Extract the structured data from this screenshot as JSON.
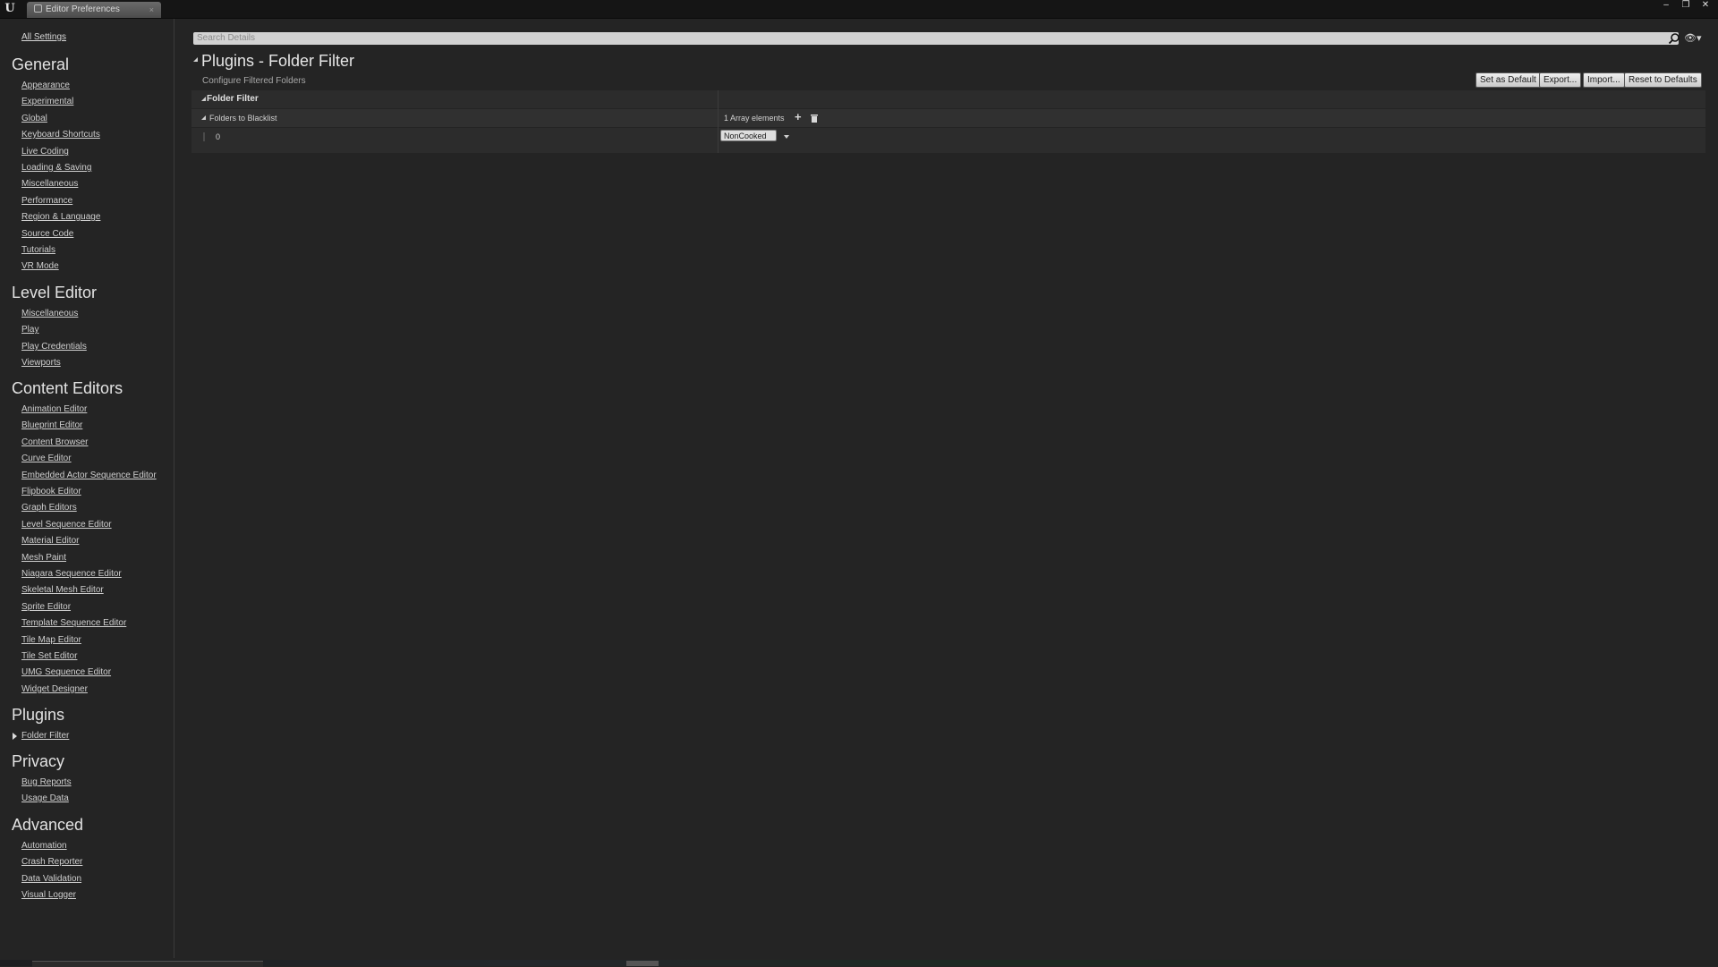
{
  "window": {
    "tab_title": "Editor Preferences",
    "tab_close": "×",
    "minimize": "–",
    "maximize": "❐",
    "close": "✕",
    "logo": "U"
  },
  "sidebar": {
    "all_settings": "All Settings",
    "categories": [
      {
        "title": "General",
        "items": [
          "Appearance",
          "Experimental",
          "Global",
          "Keyboard Shortcuts",
          "Live Coding",
          "Loading & Saving",
          "Miscellaneous",
          "Performance",
          "Region & Language",
          "Source Code",
          "Tutorials",
          "VR Mode"
        ]
      },
      {
        "title": "Level Editor",
        "items": [
          "Miscellaneous",
          "Play",
          "Play Credentials",
          "Viewports"
        ]
      },
      {
        "title": "Content Editors",
        "items": [
          "Animation Editor",
          "Blueprint Editor",
          "Content Browser",
          "Curve Editor",
          "Embedded Actor Sequence Editor",
          "Flipbook Editor",
          "Graph Editors",
          "Level Sequence Editor",
          "Material Editor",
          "Mesh Paint",
          "Niagara Sequence Editor",
          "Skeletal Mesh Editor",
          "Sprite Editor",
          "Template Sequence Editor",
          "Tile Map Editor",
          "Tile Set Editor",
          "UMG Sequence Editor",
          "Widget Designer"
        ]
      },
      {
        "title": "Plugins",
        "items": [
          "Folder Filter"
        ]
      },
      {
        "title": "Privacy",
        "items": [
          "Bug Reports",
          "Usage Data"
        ]
      },
      {
        "title": "Advanced",
        "items": [
          "Automation",
          "Crash Reporter",
          "Data Validation",
          "Visual Logger"
        ]
      }
    ],
    "selected": "Folder Filter"
  },
  "main": {
    "search_placeholder": "Search Details",
    "title": "Plugins - Folder Filter",
    "subtitle": "Configure Filtered Folders",
    "buttons": {
      "set_default": "Set as Default",
      "export": "Export...",
      "import": "Import...",
      "reset": "Reset to Defaults"
    },
    "section": {
      "title": "Folder Filter",
      "array_label": "Folders to Blacklist",
      "array_count": "1 Array elements",
      "add_icon": "+",
      "delete_icon": "🗑",
      "element_index": "0",
      "element_value": "NonCooked"
    }
  },
  "colors": {
    "background": "#242424",
    "titlebar": "#151515",
    "text": "#c8c8c8"
  }
}
